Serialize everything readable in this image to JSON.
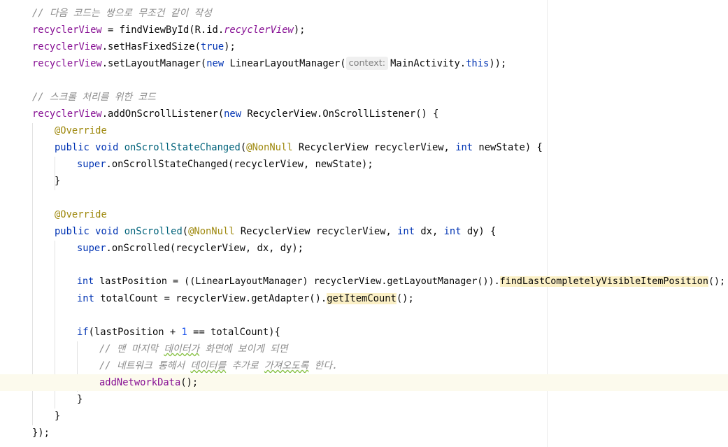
{
  "editor": {
    "lines": [
      {
        "tokens": [
          {
            "cls": "cm",
            "text": "// 다음 코드는 쌍으로 무조건 같이 작성"
          }
        ]
      },
      {
        "tokens": [
          {
            "cls": "fld",
            "text": "recyclerView"
          },
          {
            "cls": "txt",
            "text": " = findViewById(R.id."
          },
          {
            "cls": "fld-i",
            "text": "recyclerView"
          },
          {
            "cls": "txt",
            "text": ");"
          }
        ]
      },
      {
        "tokens": [
          {
            "cls": "fld",
            "text": "recyclerView"
          },
          {
            "cls": "txt",
            "text": ".setHasFixedSize("
          },
          {
            "cls": "kw",
            "text": "true"
          },
          {
            "cls": "txt",
            "text": ");"
          }
        ]
      },
      {
        "tokens": [
          {
            "cls": "fld",
            "text": "recyclerView"
          },
          {
            "cls": "txt",
            "text": ".setLayoutManager("
          },
          {
            "cls": "kw",
            "text": "new"
          },
          {
            "cls": "txt",
            "text": " LinearLayoutManager("
          },
          {
            "cls": "hint",
            "text": "context:"
          },
          {
            "cls": "txt",
            "text": "MainActivity."
          },
          {
            "cls": "kw",
            "text": "this"
          },
          {
            "cls": "txt",
            "text": "));"
          }
        ]
      },
      {
        "tokens": []
      },
      {
        "tokens": [
          {
            "cls": "cm",
            "text": "// 스크롤 처리를 위한 코드"
          }
        ]
      },
      {
        "tokens": [
          {
            "cls": "fld",
            "text": "recyclerView"
          },
          {
            "cls": "txt",
            "text": ".addOnScrollListener("
          },
          {
            "cls": "kw",
            "text": "new"
          },
          {
            "cls": "txt",
            "text": " RecyclerView.OnScrollListener() {"
          }
        ]
      },
      {
        "tokens": [
          {
            "cls": "ann",
            "text": "@Override"
          }
        ]
      },
      {
        "tokens": [
          {
            "cls": "kw",
            "text": "public void "
          },
          {
            "cls": "mdecl",
            "text": "onScrollStateChanged"
          },
          {
            "cls": "txt",
            "text": "("
          },
          {
            "cls": "ann",
            "text": "@NonNull"
          },
          {
            "cls": "txt",
            "text": " RecyclerView recyclerView, "
          },
          {
            "cls": "kw",
            "text": "int"
          },
          {
            "cls": "txt",
            "text": " newState) {"
          }
        ]
      },
      {
        "tokens": [
          {
            "cls": "kw",
            "text": "super"
          },
          {
            "cls": "txt",
            "text": ".onScrollStateChanged(recyclerView, newState);"
          }
        ]
      },
      {
        "tokens": [
          {
            "cls": "txt",
            "text": "}"
          }
        ]
      },
      {
        "tokens": []
      },
      {
        "tokens": [
          {
            "cls": "ann",
            "text": "@Override"
          }
        ]
      },
      {
        "tokens": [
          {
            "cls": "kw",
            "text": "public void "
          },
          {
            "cls": "mdecl",
            "text": "onScrolled"
          },
          {
            "cls": "txt",
            "text": "("
          },
          {
            "cls": "ann",
            "text": "@NonNull"
          },
          {
            "cls": "txt",
            "text": " RecyclerView recyclerView, "
          },
          {
            "cls": "kw",
            "text": "int"
          },
          {
            "cls": "txt",
            "text": " dx, "
          },
          {
            "cls": "kw",
            "text": "int"
          },
          {
            "cls": "txt",
            "text": " dy) {"
          }
        ]
      },
      {
        "tokens": [
          {
            "cls": "kw",
            "text": "super"
          },
          {
            "cls": "txt",
            "text": ".onScrolled(recyclerView, dx, dy);"
          }
        ]
      },
      {
        "tokens": []
      },
      {
        "tokens": [
          {
            "cls": "kw",
            "text": "int"
          },
          {
            "cls": "txt",
            "text": " lastPosition = ((LinearLayoutManager) recyclerView.getLayoutManager())."
          },
          {
            "cls": "txt hl",
            "text": "findLastCompletelyVisibleItemPosition"
          },
          {
            "cls": "txt",
            "text": "();"
          }
        ]
      },
      {
        "tokens": [
          {
            "cls": "kw",
            "text": "int"
          },
          {
            "cls": "txt",
            "text": " totalCount = recyclerView.getAdapter()."
          },
          {
            "cls": "txt hl",
            "text": "getItemCount"
          },
          {
            "cls": "txt",
            "text": "();"
          }
        ]
      },
      {
        "tokens": []
      },
      {
        "tokens": [
          {
            "cls": "kw",
            "text": "if"
          },
          {
            "cls": "txt",
            "text": "(lastPosition + "
          },
          {
            "cls": "num",
            "text": "1"
          },
          {
            "cls": "txt",
            "text": " == totalCount){"
          }
        ]
      },
      {
        "tokens": [
          {
            "cls": "cm",
            "text": "// 맨 마지막 "
          },
          {
            "cls": "cm squiggle",
            "text": "데이터가"
          },
          {
            "cls": "cm",
            "text": " 화면에 보이게 되면"
          }
        ]
      },
      {
        "tokens": [
          {
            "cls": "cm",
            "text": "// 네트워크 통해서 "
          },
          {
            "cls": "cm squiggle",
            "text": "데이터를"
          },
          {
            "cls": "cm",
            "text": " 추가로 "
          },
          {
            "cls": "cm squiggle",
            "text": "가져오도록"
          },
          {
            "cls": "cm",
            "text": " 한다."
          }
        ]
      },
      {
        "tokens": [
          {
            "cls": "fld",
            "text": "addNetworkData"
          },
          {
            "cls": "txt",
            "text": "();"
          }
        ]
      },
      {
        "tokens": [
          {
            "cls": "txt",
            "text": "}"
          }
        ]
      },
      {
        "tokens": [
          {
            "cls": "txt",
            "text": "}"
          }
        ]
      },
      {
        "tokens": [
          {
            "cls": "txt",
            "text": "});"
          }
        ]
      }
    ]
  }
}
